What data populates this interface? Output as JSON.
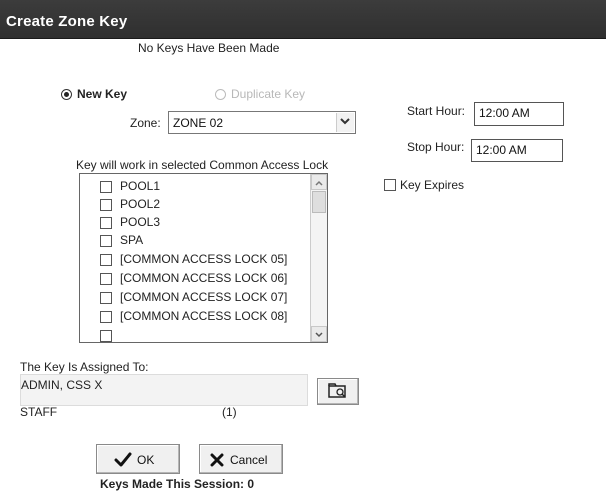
{
  "window": {
    "title": "Create Zone Key"
  },
  "status": {
    "keys_made": "No Keys Have Been Made"
  },
  "key_type": {
    "new_key": "New Key",
    "duplicate_key": "Duplicate Key"
  },
  "zone": {
    "label": "Zone:",
    "value": "ZONE 02"
  },
  "times": {
    "start_label": "Start Hour:",
    "start_value": "12:00 AM",
    "stop_label": "Stop Hour:",
    "stop_value": "12:00 AM",
    "expires_label": "Key Expires"
  },
  "locks": {
    "label": "Key will work in selected Common Access Lock",
    "items": [
      "POOL1",
      "POOL2",
      "POOL3",
      "SPA",
      "[COMMON ACCESS LOCK 05]",
      "[COMMON ACCESS LOCK 06]",
      "[COMMON ACCESS LOCK 07]",
      "[COMMON ACCESS LOCK 08]"
    ]
  },
  "assigned": {
    "label": "The Key Is Assigned To:",
    "name": "ADMIN, CSS X",
    "role": "STAFF",
    "count": "(1)"
  },
  "buttons": {
    "ok": "OK",
    "cancel": "Cancel"
  },
  "footer": {
    "session": "Keys Made This Session: 0"
  },
  "icons": {
    "ok": "check-icon",
    "cancel": "x-icon",
    "lookup": "folder-search-icon"
  }
}
